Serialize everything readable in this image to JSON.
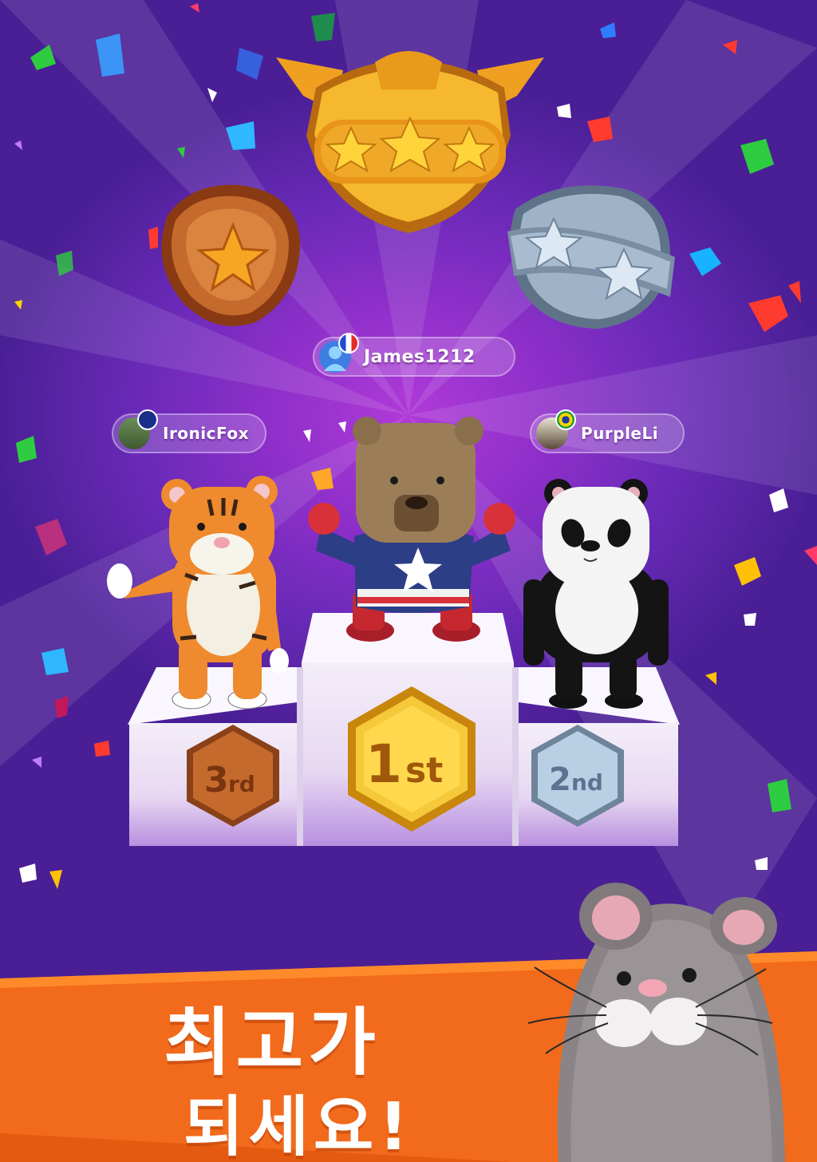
{
  "colors": {
    "background": "#7a2cc2",
    "banner": "#f26a1b",
    "gold": "#f5b82e",
    "silver": "#9fb3c8",
    "bronze": "#c56a2d"
  },
  "medals": {
    "left": {
      "stars": 1,
      "icon": "bronze-medal-icon"
    },
    "center": {
      "stars": 3,
      "icon": "gold-crown-medal-icon"
    },
    "right": {
      "stars": 2,
      "icon": "silver-medal-icon"
    }
  },
  "players": {
    "first": {
      "name": "James1212",
      "flag": "france-flag-icon",
      "character": "bear-superhero-icon"
    },
    "second": {
      "name": "PurpleLi",
      "flag": "brazil-flag-icon",
      "character": "panda-icon"
    },
    "third": {
      "name": "IronicFox",
      "flag": "australia-flag-icon",
      "character": "tiger-icon"
    }
  },
  "podium": {
    "first_label": {
      "num": "1",
      "suffix": "st"
    },
    "second_label": {
      "num": "2",
      "suffix": "nd"
    },
    "third_label": {
      "num": "3",
      "suffix": "rd"
    }
  },
  "slogan": {
    "line1": "최고가",
    "line2": "되세요!"
  },
  "mascot": "mouse-icon"
}
